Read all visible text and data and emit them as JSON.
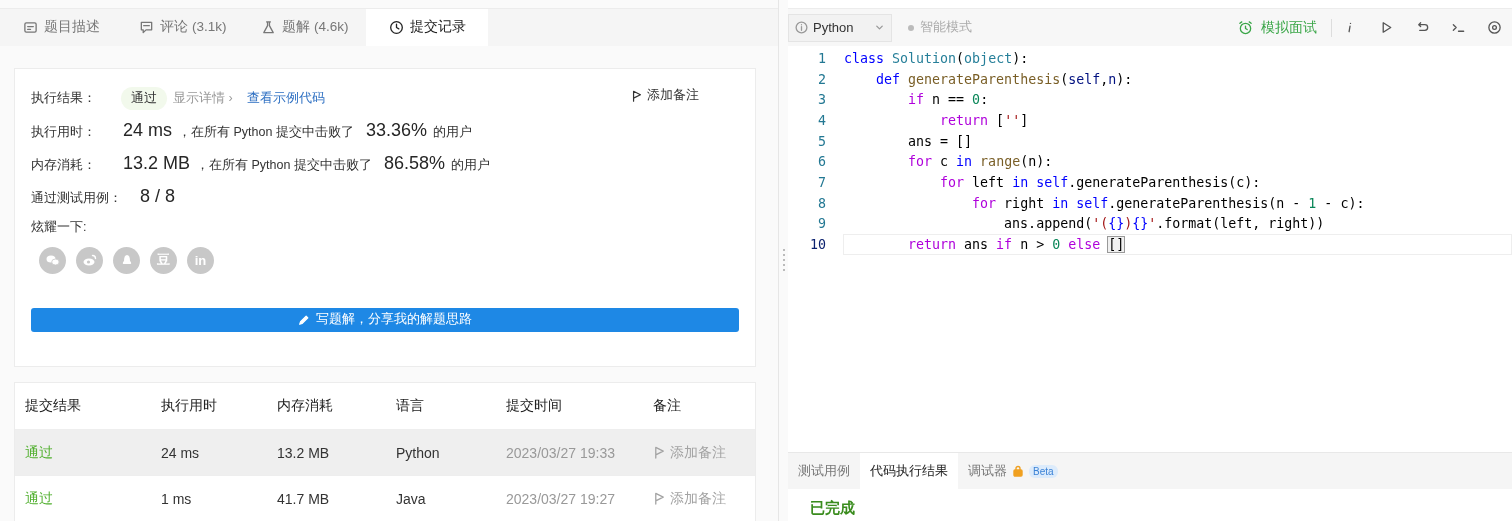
{
  "left_tabs": [
    {
      "label": "题目描述",
      "kind": "description",
      "selected": false
    },
    {
      "label": "评论 (3.1k)",
      "kind": "comments",
      "selected": false
    },
    {
      "label": "题解 (4.6k)",
      "kind": "solutions",
      "selected": false
    },
    {
      "label": "提交记录",
      "kind": "submissions",
      "selected": true
    }
  ],
  "result": {
    "result_label": "执行结果：",
    "status": "通过",
    "details_link": "显示详情 ›",
    "sample_link": "查看示例代码",
    "note_button": "添加备注",
    "runtime_label": "执行用时：",
    "runtime": "24 ms",
    "runtime_text": "，在所有 Python 提交中击败了",
    "runtime_pct": "33.36%",
    "runtime_suffix": "的用户",
    "memory_label": "内存消耗：",
    "memory": "13.2 MB",
    "memory_text": "，在所有 Python 提交中击败了",
    "memory_pct": "86.58%",
    "memory_suffix": "的用户",
    "cases_label": "通过测试用例：",
    "cases": "8 / 8",
    "share_label": "炫耀一下:",
    "share": [
      {
        "kind": "wechat"
      },
      {
        "kind": "weibo"
      },
      {
        "kind": "qq"
      },
      {
        "kind": "douban",
        "glyph": "豆"
      },
      {
        "kind": "linkedin",
        "glyph": "in"
      }
    ],
    "write_button": "写题解，分享我的解题思路"
  },
  "table": {
    "columns": [
      "提交结果",
      "执行用时",
      "内存消耗",
      "语言",
      "提交时间",
      "备注"
    ],
    "rows": [
      {
        "status": "通过",
        "runtime": "24 ms",
        "memory": "13.2 MB",
        "language": "Python",
        "time": "2023/03/27 19:33",
        "note": "添加备注",
        "selected": true
      },
      {
        "status": "通过",
        "runtime": "1 ms",
        "memory": "41.7 MB",
        "language": "Java",
        "time": "2023/03/27 19:27",
        "note": "添加备注",
        "selected": false
      }
    ]
  },
  "editor": {
    "language": "Python",
    "mode": "智能模式",
    "interview": "模拟面试",
    "lines": [
      {
        "number": "1",
        "current": false,
        "tokens": [
          {
            "text": "class",
            "kind": "kw"
          },
          {
            "text": " Solution",
            "kind": "cls"
          },
          {
            "text": "(",
            "kind": "plain"
          },
          {
            "text": "object",
            "kind": "cls"
          },
          {
            "text": "):",
            "kind": "plain"
          }
        ]
      },
      {
        "number": "2",
        "current": false,
        "tokens": [
          {
            "text": "    def",
            "kind": "kw"
          },
          {
            "text": " generateParenthesis",
            "kind": "fn"
          },
          {
            "text": "(",
            "kind": "plain"
          },
          {
            "text": "self",
            "kind": "var"
          },
          {
            "text": ",",
            "kind": "plain"
          },
          {
            "text": "n",
            "kind": "var"
          },
          {
            "text": "):",
            "kind": "plain"
          }
        ]
      },
      {
        "number": "3",
        "current": false,
        "tokens": [
          {
            "text": "        if",
            "kind": "ctrl"
          },
          {
            "text": " n == ",
            "kind": "plain"
          },
          {
            "text": "0",
            "kind": "num"
          },
          {
            "text": ":",
            "kind": "plain"
          }
        ]
      },
      {
        "number": "4",
        "current": false,
        "tokens": [
          {
            "text": "            return",
            "kind": "ctrl"
          },
          {
            "text": " [",
            "kind": "plain"
          },
          {
            "text": "''",
            "kind": "str"
          },
          {
            "text": "]",
            "kind": "plain"
          }
        ]
      },
      {
        "number": "5",
        "current": false,
        "tokens": [
          {
            "text": "        ans = []",
            "kind": "plain"
          }
        ]
      },
      {
        "number": "6",
        "current": false,
        "tokens": [
          {
            "text": "        for",
            "kind": "ctrl"
          },
          {
            "text": " c ",
            "kind": "plain"
          },
          {
            "text": "in",
            "kind": "kw"
          },
          {
            "text": " range",
            "kind": "fn"
          },
          {
            "text": "(n):",
            "kind": "plain"
          }
        ]
      },
      {
        "number": "7",
        "current": false,
        "tokens": [
          {
            "text": "            for",
            "kind": "ctrl"
          },
          {
            "text": " left ",
            "kind": "plain"
          },
          {
            "text": "in",
            "kind": "kw"
          },
          {
            "text": " self",
            "kind": "kw"
          },
          {
            "text": ".generateParenthesis(c):",
            "kind": "plain"
          }
        ]
      },
      {
        "number": "8",
        "current": false,
        "tokens": [
          {
            "text": "                for",
            "kind": "ctrl"
          },
          {
            "text": " right ",
            "kind": "plain"
          },
          {
            "text": "in",
            "kind": "kw"
          },
          {
            "text": " self",
            "kind": "kw"
          },
          {
            "text": ".generateParenthesis(n - ",
            "kind": "plain"
          },
          {
            "text": "1",
            "kind": "num"
          },
          {
            "text": " - c):",
            "kind": "plain"
          }
        ]
      },
      {
        "number": "9",
        "current": false,
        "tokens": [
          {
            "text": "                    ans.append(",
            "kind": "plain"
          },
          {
            "text": "'(",
            "kind": "str"
          },
          {
            "text": "{}",
            "kind": "kw"
          },
          {
            "text": ")",
            "kind": "str"
          },
          {
            "text": "{}",
            "kind": "kw"
          },
          {
            "text": "'",
            "kind": "str"
          },
          {
            "text": ".format(left, right))",
            "kind": "plain"
          }
        ]
      },
      {
        "number": "10",
        "current": true,
        "tokens": [
          {
            "text": "        return",
            "kind": "ctrl"
          },
          {
            "text": " ans ",
            "kind": "plain"
          },
          {
            "text": "if",
            "kind": "ctrl"
          },
          {
            "text": " n > ",
            "kind": "plain"
          },
          {
            "text": "0",
            "kind": "num"
          },
          {
            "text": " else ",
            "kind": "ctrl"
          },
          {
            "text": "[]",
            "kind": "bracket"
          }
        ]
      }
    ]
  },
  "console": {
    "tabs": [
      {
        "label": "测试用例",
        "selected": false
      },
      {
        "label": "代码执行结果",
        "selected": true
      },
      {
        "label": "调试器",
        "selected": false,
        "locked": true,
        "badge": "Beta"
      }
    ],
    "status": "已完成"
  }
}
